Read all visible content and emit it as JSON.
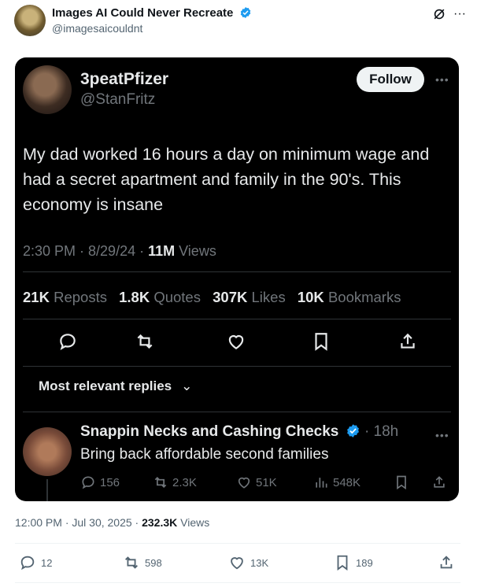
{
  "outer_post": {
    "name": "Images AI Could Never Recreate",
    "handle": "@imagesaicouldnt",
    "timestamp": "12:00 PM · Jul 30, 2025 · ",
    "views_count": "232.3K",
    "views_label": " Views",
    "actions": {
      "replies": "12",
      "reposts": "598",
      "likes": "13K",
      "bookmarks": "189"
    }
  },
  "embedded_post": {
    "name": "3peatPfizer",
    "handle": "@StanFritz",
    "follow_label": "Follow",
    "text": "My dad worked 16 hours a day on minimum wage and had a secret apartment and family in the 90's. This economy is insane",
    "time": "2:30 PM · 8/29/24 · ",
    "views_count": "11M",
    "views_label": " Views",
    "stats": {
      "reposts_count": "21K",
      "reposts_label": "Reposts",
      "quotes_count": "1.8K",
      "quotes_label": "Quotes",
      "likes_count": "307K",
      "likes_label": "Likes",
      "bookmarks_count": "10K",
      "bookmarks_label": "Bookmarks"
    },
    "replies_sort_label": "Most relevant replies"
  },
  "reply": {
    "name": "Snappin Necks and Cashing Checks",
    "time": "· 18h",
    "text": "Bring back affordable second families",
    "replies": "156",
    "reposts": "2.3K",
    "likes": "51K",
    "views": "548K"
  },
  "colors": {
    "verified": "#1d9bf0",
    "card_bg": "#000000",
    "muted": "#71767b"
  }
}
